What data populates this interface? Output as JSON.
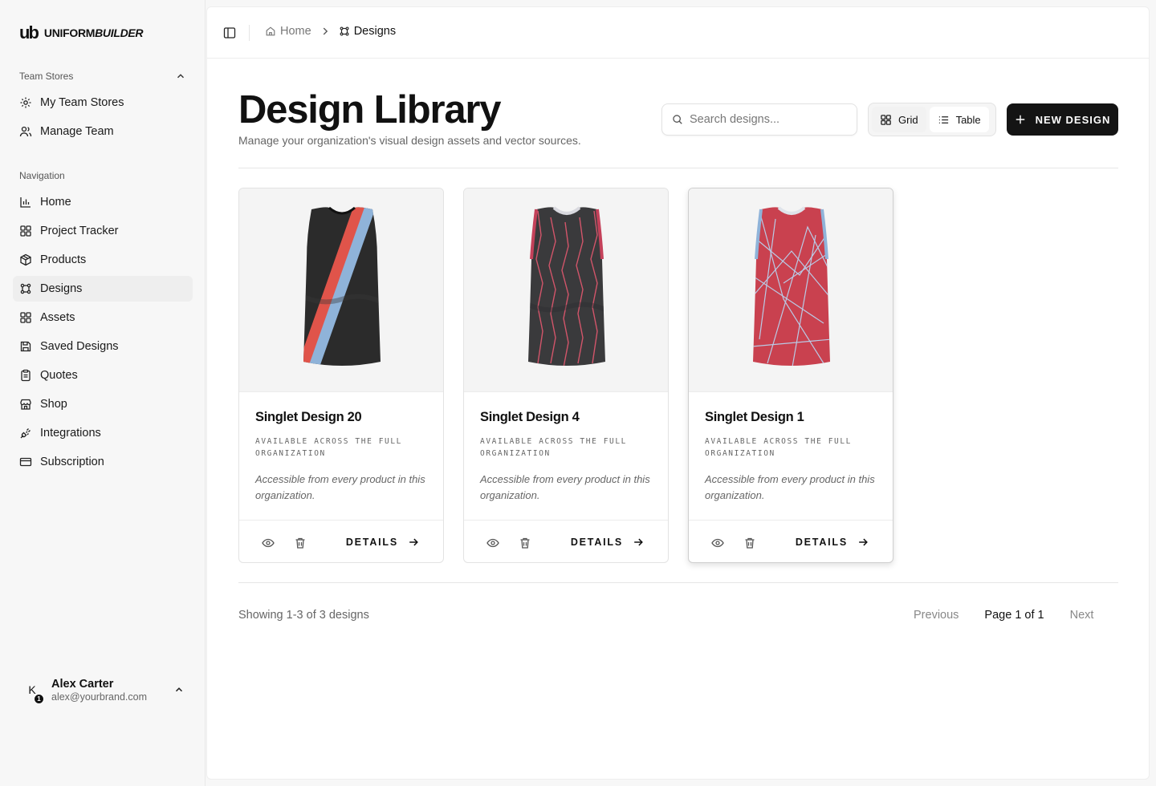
{
  "brand": {
    "mark": "ub",
    "name_plain": "UNIFORM",
    "name_italic": "BUILDER"
  },
  "sidebar": {
    "team_section": "Team Stores",
    "team_items": [
      {
        "label": "My Team Stores",
        "icon": "gear-icon"
      },
      {
        "label": "Manage Team",
        "icon": "users-icon"
      }
    ],
    "nav_section": "Navigation",
    "nav_items": [
      {
        "label": "Home",
        "icon": "bar-chart-icon"
      },
      {
        "label": "Project Tracker",
        "icon": "layout-grid-icon"
      },
      {
        "label": "Products",
        "icon": "package-icon"
      },
      {
        "label": "Designs",
        "icon": "frame-icon",
        "active": true
      },
      {
        "label": "Assets",
        "icon": "layout-grid-icon"
      },
      {
        "label": "Saved Designs",
        "icon": "save-icon"
      },
      {
        "label": "Quotes",
        "icon": "clipboard-icon"
      },
      {
        "label": "Shop",
        "icon": "store-icon"
      },
      {
        "label": "Integrations",
        "icon": "plug-icon"
      },
      {
        "label": "Subscription",
        "icon": "credit-card-icon"
      }
    ],
    "user": {
      "initial": "K",
      "badge": "1",
      "name": "Alex Carter",
      "email": "alex@yourbrand.com"
    }
  },
  "breadcrumb": {
    "home": "Home",
    "current": "Designs"
  },
  "header": {
    "title": "Design Library",
    "subtitle": "Manage your organization's visual design assets and vector sources.",
    "search_placeholder": "Search designs...",
    "view_grid": "Grid",
    "view_table": "Table",
    "new_button": "NEW DESIGN"
  },
  "cards": [
    {
      "title": "Singlet Design 20",
      "scope": "AVAILABLE ACROSS THE FULL ORGANIZATION",
      "description": "Accessible from every product in this organization.",
      "details": "DETAILS"
    },
    {
      "title": "Singlet Design 4",
      "scope": "AVAILABLE ACROSS THE FULL ORGANIZATION",
      "description": "Accessible from every product in this organization.",
      "details": "DETAILS"
    },
    {
      "title": "Singlet Design 1",
      "scope": "AVAILABLE ACROSS THE FULL ORGANIZATION",
      "description": "Accessible from every product in this organization.",
      "details": "DETAILS"
    }
  ],
  "footer": {
    "showing": "Showing 1-3 of 3 designs",
    "previous": "Previous",
    "page": "Page 1 of 1",
    "next": "Next"
  },
  "colors": {
    "accent": "#141414",
    "jersey_red": "#c9414f",
    "jersey_dark": "#2b2b2b",
    "stripe_blue": "#8fb3d9",
    "stripe_red": "#e0544a"
  }
}
